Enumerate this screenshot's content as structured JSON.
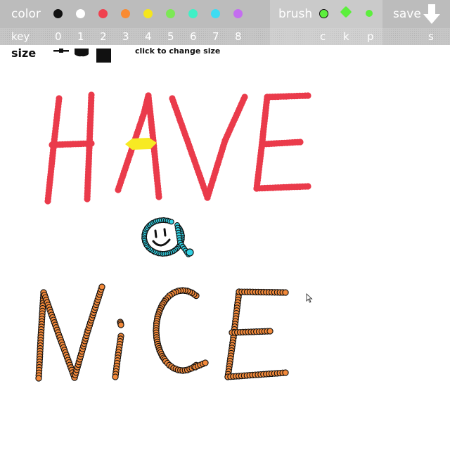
{
  "toolbar": {
    "color_label": "color",
    "brush_label": "brush",
    "save_label": "save",
    "key_label": "key",
    "color_swatches": [
      {
        "key": "0",
        "color": "#111111"
      },
      {
        "key": "1",
        "color": "#ffffff"
      },
      {
        "key": "2",
        "color": "#f0414f"
      },
      {
        "key": "3",
        "color": "#f98b32"
      },
      {
        "key": "4",
        "color": "#f5e61e"
      },
      {
        "key": "5",
        "color": "#7ce855"
      },
      {
        "key": "6",
        "color": "#3ff0c6"
      },
      {
        "key": "7",
        "color": "#3edcf2"
      },
      {
        "key": "8",
        "color": "#c46ef0"
      }
    ],
    "brush_keys": [
      "c",
      "k",
      "p"
    ],
    "save_key": "s",
    "brush_icons": [
      "circle-brush-icon",
      "diamond-brush-icon",
      "dot-brush-icon"
    ],
    "save_icon": "down-arrow-icon"
  },
  "size": {
    "label": "size",
    "hint": "click to change size",
    "options": [
      "small-brush-size-icon",
      "medium-brush-size-icon",
      "large-brush-size-icon"
    ]
  },
  "drawing": {
    "colors": {
      "red": "#ea3b4b",
      "yellow": "#f7ea23",
      "cyan": "#32d1e3",
      "orange": "#f2893a",
      "outline": "#111111"
    }
  }
}
